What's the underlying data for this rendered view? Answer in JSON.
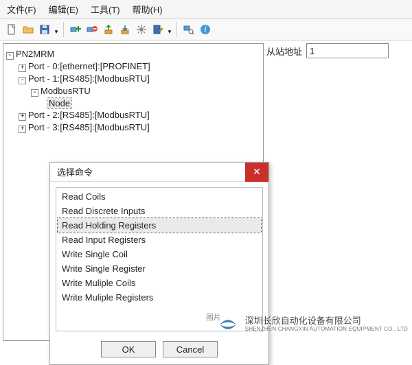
{
  "menu": {
    "file": "文件(F)",
    "edit": "编辑(E)",
    "tools": "工具(T)",
    "help": "帮助(H)"
  },
  "tree": {
    "root": "PN2MRM",
    "n0": "Port - 0:[ethernet]:[PROFINET]",
    "n1": "Port - 1:[RS485]:[ModbusRTU]",
    "n1a": "ModbusRTU",
    "n1b": "Node",
    "n2": "Port - 2:[RS485]:[ModbusRTU]",
    "n3": "Port - 3:[RS485]:[ModbusRTU]"
  },
  "panel": {
    "addrLabel": "从站地址",
    "addrValue": "1"
  },
  "dialog": {
    "title": "选择命令",
    "items": [
      "Read Coils",
      "Read Discrete Inputs",
      "Read Holding Registers",
      "Read Input Registers",
      "Write Single Coil",
      "Write Single Register",
      "Write Muliple Coils",
      "Write Muliple Registers"
    ],
    "ok": "OK",
    "cancel": "Cancel"
  },
  "caption": "图片",
  "watermark": {
    "cn": "深圳长欣自动化设备有限公司",
    "en": "SHENZHEN CHANGXIN AUTOMATION EQUIPMENT CO., LTD"
  }
}
